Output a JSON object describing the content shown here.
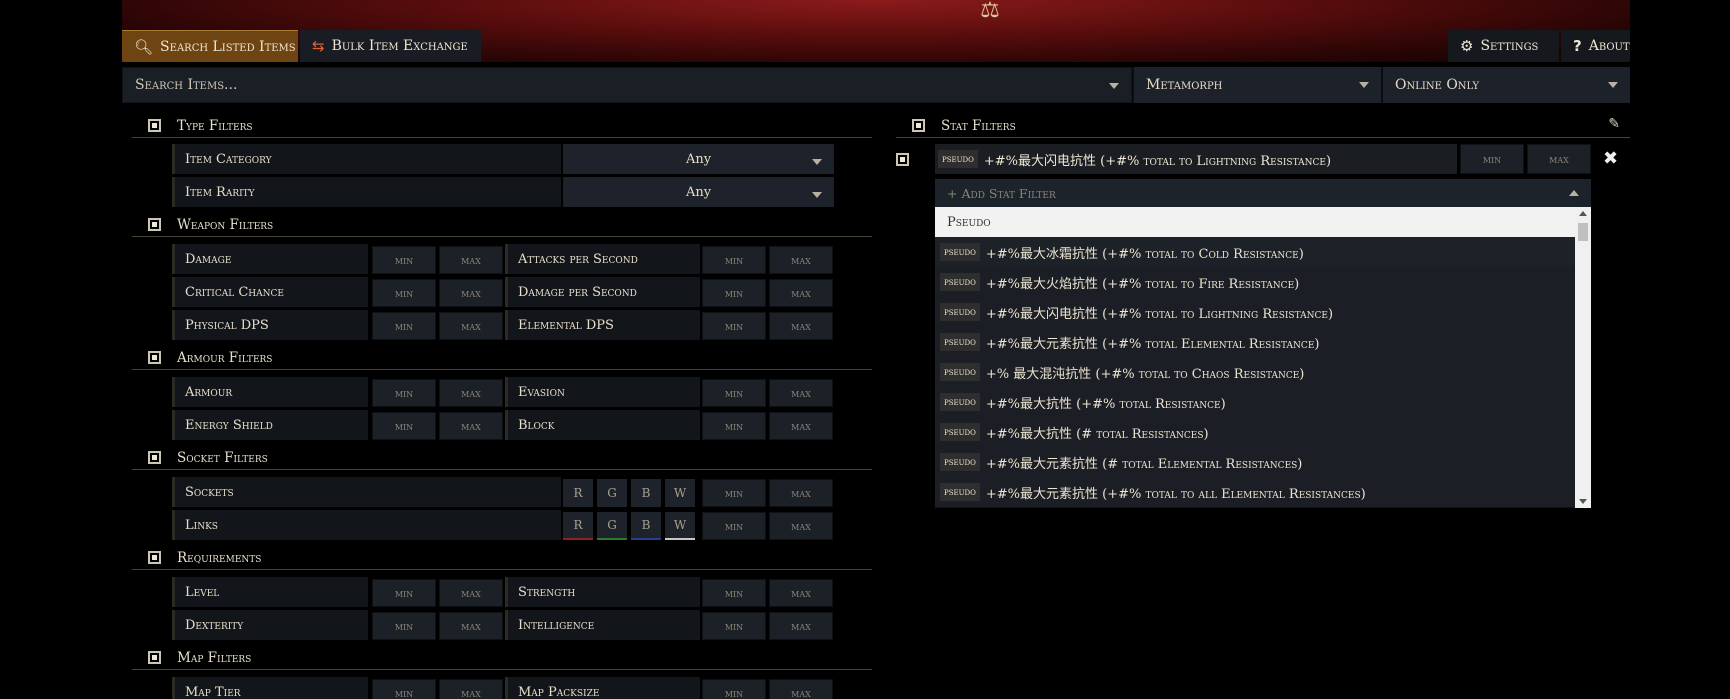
{
  "tabs": {
    "search": "Search Listed Items",
    "bulk": "Bulk Item Exchange",
    "settings": "Settings",
    "about": "About"
  },
  "search": {
    "placeholder": "Search Items...",
    "league": "Metamorph",
    "status": "Online Only"
  },
  "type_filters": {
    "title": "Type Filters",
    "rows": [
      {
        "label": "Item Category",
        "value": "Any"
      },
      {
        "label": "Item Rarity",
        "value": "Any"
      }
    ]
  },
  "weapon_filters": {
    "title": "Weapon Filters",
    "rows": [
      {
        "left": "Damage",
        "right": "Attacks per Second"
      },
      {
        "left": "Critical Chance",
        "right": "Damage per Second"
      },
      {
        "left": "Physical DPS",
        "right": "Elemental DPS"
      }
    ]
  },
  "armour_filters": {
    "title": "Armour Filters",
    "rows": [
      {
        "left": "Armour",
        "right": "Evasion"
      },
      {
        "left": "Energy Shield",
        "right": "Block"
      }
    ]
  },
  "socket_filters": {
    "title": "Socket Filters",
    "rows": [
      {
        "label": "Sockets"
      },
      {
        "label": "Links"
      }
    ],
    "colors": [
      "R",
      "G",
      "B",
      "W"
    ]
  },
  "requirements": {
    "title": "Requirements",
    "rows": [
      {
        "left": "Level",
        "right": "Strength"
      },
      {
        "left": "Dexterity",
        "right": "Intelligence"
      }
    ]
  },
  "map_filters": {
    "title": "Map Filters",
    "rows": [
      {
        "left": "Map Tier",
        "right": "Map Packsize"
      }
    ]
  },
  "minmax": {
    "min": "min",
    "max": "max"
  },
  "stat_filters": {
    "title": "Stat Filters",
    "active": {
      "tag": "pseudo",
      "text": "+#%最大闪电抗性 (+#% total to Lightning Resistance)"
    },
    "add_placeholder": "+ Add Stat Filter",
    "group": "Pseudo",
    "options": [
      "+#%最大冰霜抗性 (+#% total to Cold Resistance)",
      "+#%最大火焰抗性 (+#% total to Fire Resistance)",
      "+#%最大闪电抗性 (+#% total to Lightning Resistance)",
      "+#%最大元素抗性 (+#% total Elemental Resistance)",
      "+% 最大混沌抗性 (+#% total to Chaos Resistance)",
      "+#%最大抗性 (+#% total Resistance)",
      "+#%最大抗性 (# total Resistances)",
      "+#%最大元素抗性 (# total Elemental Resistances)",
      "+#%最大元素抗性 (+#% total to all Elemental Resistances)"
    ]
  }
}
